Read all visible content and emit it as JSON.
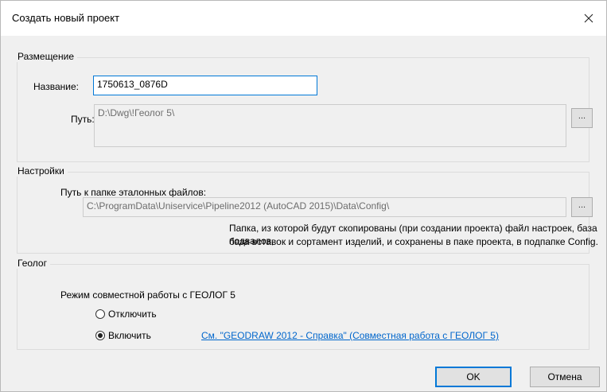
{
  "window": {
    "title": "Создать новый проект",
    "close_icon": "close-icon"
  },
  "placement": {
    "group_title": "Размещение",
    "name_label": "Название:",
    "name_value": "1750613_0876D",
    "path_label": "Путь:",
    "path_value": "D:\\Dwg\\!Геолог 5\\",
    "browse_label": "..."
  },
  "settings": {
    "group_title": "Настройки",
    "ref_folder_label": "Путь к папке эталонных файлов:",
    "ref_folder_value": "C:\\ProgramData\\Uniservice\\Pipeline2012 (AutoCAD 2015)\\Data\\Config\\",
    "browse_label": "...",
    "note_line1": "Папка, из которой будут скопированы (при создании проекта) файл настроек, база подвалов,",
    "note_line2": "база вставок и сортамент изделий, и сохранены в паке проекта, в подпапке Config."
  },
  "geolog": {
    "group_title": "Геолог",
    "mode_label": "Режим совместной работы с ГЕОЛОГ 5",
    "option_off": "Отключить",
    "option_on": "Включить",
    "selected": "Включить",
    "help_link": "См. \"GEODRAW 2012 - Справка\" (Совместная работа с ГЕОЛОГ 5)"
  },
  "buttons": {
    "ok": "OK",
    "cancel": "Отмена"
  }
}
